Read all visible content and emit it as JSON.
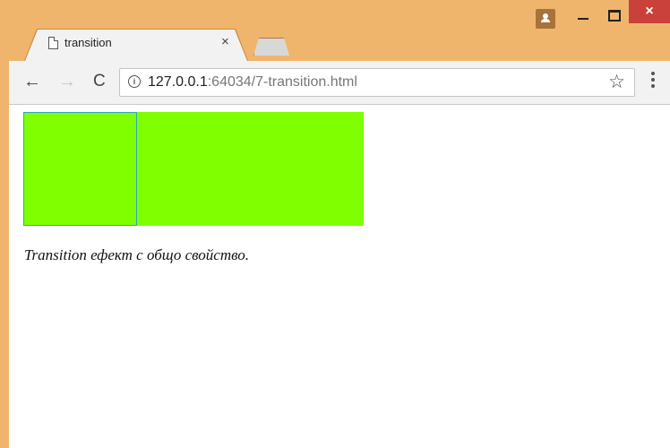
{
  "tab": {
    "title": "transition",
    "close_glyph": "×"
  },
  "toolbar": {
    "back_glyph": "←",
    "forward_glyph": "→",
    "reload_glyph": "C",
    "url_host": "127.0.0.1",
    "url_path": ":64034/7-transition.html",
    "bookmark_glyph": "☆"
  },
  "window": {
    "close_glyph": "×"
  },
  "page": {
    "caption": "Transition ефект с общо свойство.",
    "box_color": "#7fff00"
  },
  "icons": [
    "profile-icon",
    "minimize-icon",
    "maximize-icon",
    "close-icon",
    "page-icon",
    "info-icon",
    "star-icon",
    "menu-icon"
  ]
}
